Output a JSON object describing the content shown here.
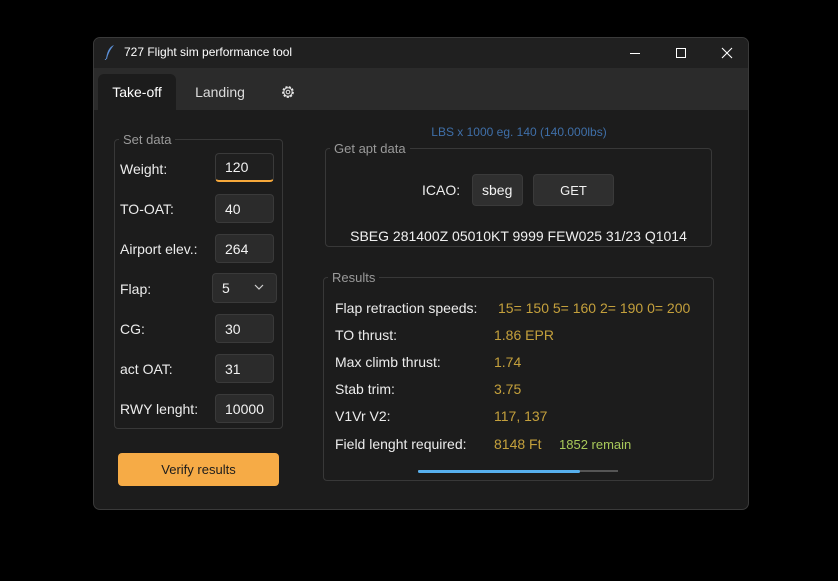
{
  "window": {
    "title": "727 Flight sim performance tool"
  },
  "tabs": [
    {
      "label": "Take-off",
      "selected": true
    },
    {
      "label": "Landing",
      "selected": false
    },
    {
      "icon": "gear-icon"
    }
  ],
  "setdata": {
    "legend": "Set data",
    "fields": {
      "weight": {
        "label": "Weight:",
        "value": "120"
      },
      "to_oat": {
        "label": "TO-OAT:",
        "value": "40"
      },
      "airport_elev": {
        "label": "Airport elev.:",
        "value": "264"
      },
      "flap": {
        "label": "Flap:",
        "value": "5"
      },
      "cg": {
        "label": "CG:",
        "value": "30"
      },
      "act_oat": {
        "label": "act OAT:",
        "value": "31"
      },
      "rwy_length": {
        "label": "RWY lenght:",
        "value": "10000"
      }
    },
    "verify_label": "Verify results"
  },
  "hint": "LBS x 1000 eg. 140 (140.000lbs)",
  "apt": {
    "legend": "Get apt data",
    "icao_label": "ICAO:",
    "icao_value": "sbeg",
    "get_label": "GET",
    "metar": "SBEG 281400Z 05010KT 9999 FEW025 31/23 Q1014"
  },
  "results": {
    "legend": "Results",
    "flap_speeds": {
      "label": "Flap retraction speeds:",
      "value": "15= 150 5= 160 2= 190 0= 200"
    },
    "to_thrust": {
      "label": "TO thrust:",
      "value": "1.86 EPR"
    },
    "max_climb": {
      "label": "Max climb thrust:",
      "value": "1.74"
    },
    "stab_trim": {
      "label": "Stab trim:",
      "value": "3.75"
    },
    "v_speeds": {
      "label": "V1Vr V2:",
      "value": "117, 137"
    },
    "field_length": {
      "label": "Field lenght required:",
      "value": "8148 Ft",
      "remain": "1852 remain"
    },
    "progress": 0.81
  },
  "colors": {
    "accent": "#f6ab46",
    "value": "#c4a03c",
    "remain": "#a9c95a",
    "hint": "#3f6fa8",
    "progress": "#57b0ee"
  }
}
